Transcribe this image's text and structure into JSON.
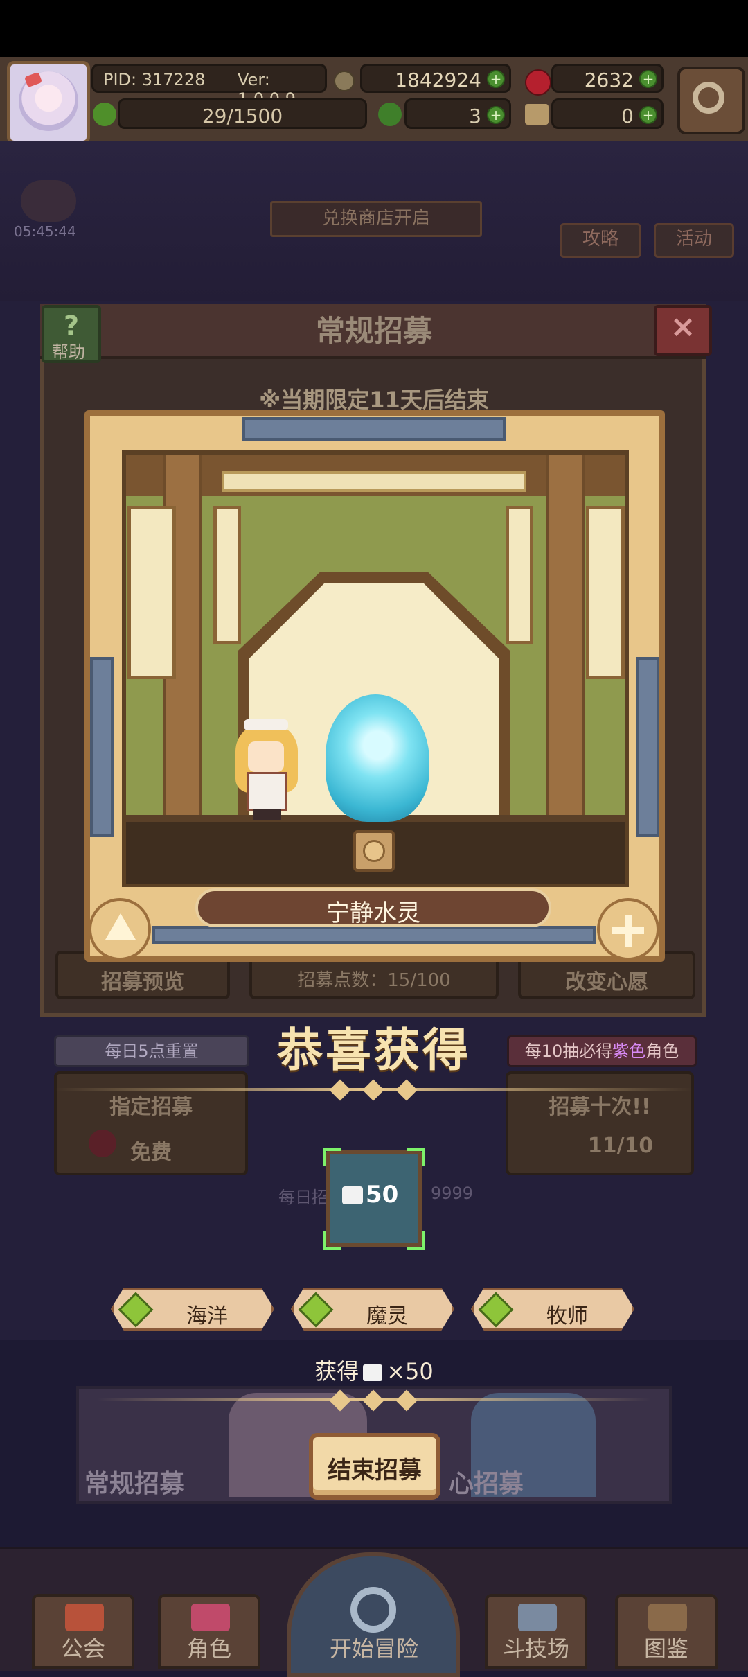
{
  "topbar": {
    "pid": "PID: 317228",
    "ver": "Ver: 1.0.0.9",
    "gold": "1842924",
    "gems": "2632",
    "stamina": "29/1500",
    "clover": "3",
    "key": "0"
  },
  "background": {
    "timer": "05:45:44",
    "shop_banner": "兑换商店开启",
    "strategy": "攻略",
    "event": "活动"
  },
  "panel": {
    "title": "常规招募",
    "help_label": "帮助",
    "notice": "※当期限定11天后结束",
    "preview": "招募预览",
    "points": "招募点数：15/100",
    "change_wish": "改变心愿",
    "reset_tag": "每日5点重置",
    "pity_tag_prefix": "每10抽必得",
    "pity_tag_color": "紫色",
    "pity_tag_suffix": "角色",
    "designated": "指定招募",
    "free": "免费",
    "recruit_ten": "招募十次!!",
    "ten_count": "11/10",
    "daily_limit": "每日招",
    "limit_value": "9999"
  },
  "reveal": {
    "character_name": "宁静水灵"
  },
  "result": {
    "congrats": "恭喜获得",
    "item_qty": "50",
    "tags": [
      "海洋",
      "魔灵",
      "牧师"
    ],
    "obtain_prefix": "获得",
    "obtain_suffix": "×50",
    "end_button": "结束招募"
  },
  "banners": {
    "left": "常规招募",
    "right": "心招募"
  },
  "nav": {
    "guild": "公会",
    "character": "角色",
    "adventure": "开始冒险",
    "arena": "斗技场",
    "codex": "图鉴"
  },
  "colors": {
    "accent_gold": "#e8c88c",
    "item_highlight": "#7df26a",
    "tag_gem": "#8ec53a"
  }
}
